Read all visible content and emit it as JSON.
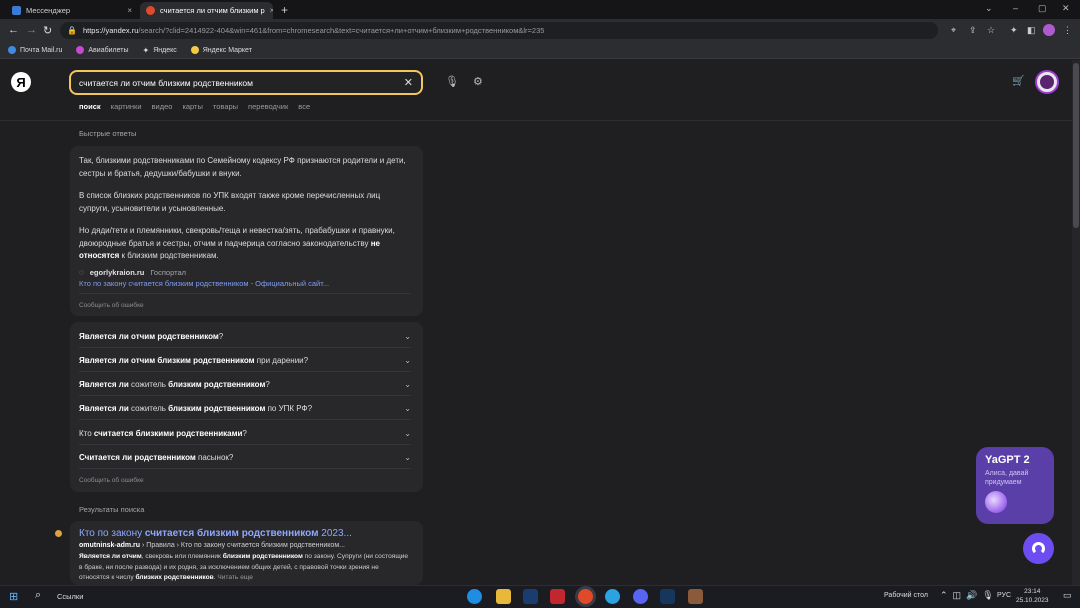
{
  "browser": {
    "tabs": [
      {
        "title": "Мессенджер"
      },
      {
        "title": "считается ли отчим близким р"
      }
    ],
    "close_glyph": "×",
    "new_tab": "+",
    "url_host": "https://yandex.ru",
    "url_path": "/search/?clid=2414922-404&win=461&from=chromesearch&text=считается+ли+отчим+близким+родственником&lr=235",
    "bookmarks": [
      "Почта Mail.ru",
      "Авиабилеты",
      "Яндекс",
      "Яндекс Маркет"
    ]
  },
  "header": {
    "logo": "Я",
    "query": "считается ли отчим близким родственником",
    "tabs": [
      "поиск",
      "картинки",
      "видео",
      "карты",
      "товары",
      "переводчик",
      "все"
    ]
  },
  "quick_answers": {
    "heading": "Быстрые ответы",
    "p1": "Так, близкими родственниками по Семейному кодексу РФ признаются родители и дети, сестры и братья, дедушки/бабушки и внуки.",
    "p2": "В список близких родственников по УПК входят также кроме перечисленных лиц супруги, усыновители и усыновленные.",
    "p3_a": "Но дяди/тети и племянники, свекровь/теща и невестка/зять, прабабушки и правнуки, двоюродные братья и сестры, отчим и падчерица согласно законодательству",
    "p3_b": "не относятся",
    "p3_c": "к близким родственникам.",
    "source_domain": "egorlykraion.ru",
    "source_sub": "Госпортал",
    "source_link": "Кто по закону считается близким родственником - Официальный сайт...",
    "report": "Сообщить об ошибке"
  },
  "faq": {
    "items": [
      {
        "bold": "Является ли отчим родственником",
        "rest": "?"
      },
      {
        "bold": "Является ли отчим близким родственником",
        "rest": " при дарении?"
      },
      {
        "bold": "Является ли",
        "mid": " сожитель ",
        "bold2": "близким родственником",
        "rest": "?"
      },
      {
        "bold": "Является ли",
        "mid": " сожитель ",
        "bold2": "близким родственником",
        "rest": " по УПК РФ?"
      },
      {
        "pre": "Кто ",
        "bold": "считается близкими родственниками",
        "rest": "?"
      },
      {
        "bold": "Считается ли родственником",
        "rest": " пасынок?"
      }
    ],
    "report": "Сообщить об ошибке"
  },
  "results": {
    "heading": "Результаты поиска",
    "title_pre": "Кто по закону ",
    "title_bold": "считается близким родственником",
    "title_post": " 2023...",
    "domain": "omutninsk-adm.ru",
    "breadcrumb": " › Правила › Кто по закону считается близким родственником...",
    "snippet_b1": "Является ли отчим",
    "snippet_t1": ", свекровь или племянник ",
    "snippet_b2": "близким родственником",
    "snippet_t2": " по закону. Супруги (ни состоящие в браке, ни после развода) и их родня, за исключением общих детей, с правовой точки зрения не относятся к числу ",
    "snippet_b3": "близких родственников",
    "snippet_t3": ". ",
    "read_more": "Читать еще"
  },
  "yagpt": {
    "title": "YaGPT 2",
    "subtitle": "Алиса, давай придумаем"
  },
  "taskbar": {
    "search_label": "Ссылки",
    "desktop": "Рабочий стол",
    "lang": "РУС",
    "time": "23:14",
    "date": "25.10.2023"
  },
  "colors": {
    "accent_yellow": "#f0c75a",
    "link": "#8fa8ff",
    "alice": "#6d4df2",
    "yagpt_bg": "#5a3fa8"
  }
}
